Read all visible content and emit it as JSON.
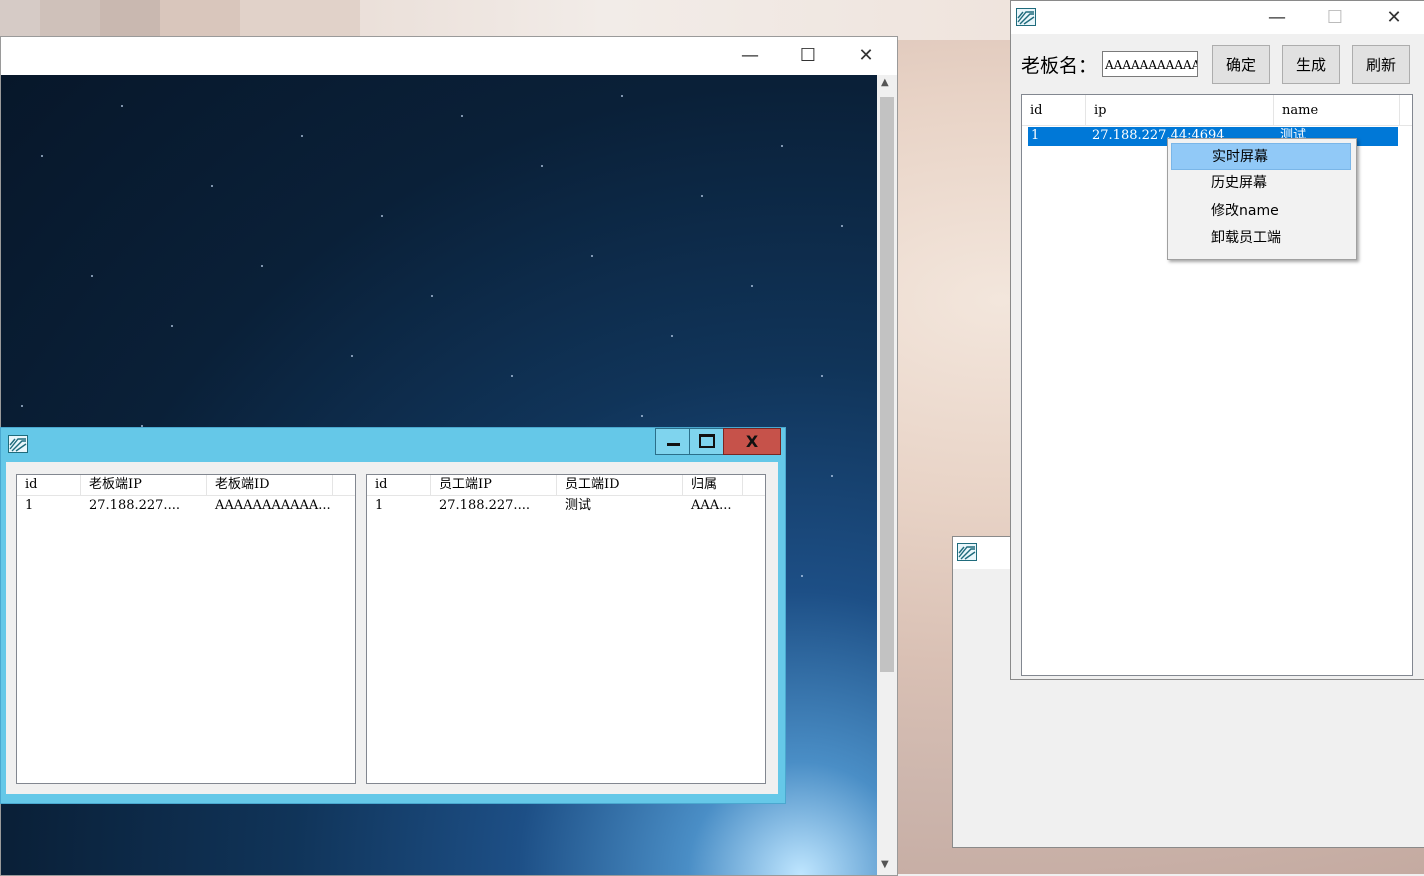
{
  "big_window": {
    "title_controls": {
      "minimize": "—",
      "maximize": "☐",
      "close": "✕"
    },
    "scroll_up": "▲",
    "scroll_down": "▼"
  },
  "client_window": {
    "buttons": {
      "close": "X"
    },
    "boss_list": {
      "columns": [
        "id",
        "老板端IP",
        "老板端ID"
      ],
      "rows": [
        [
          "1",
          "27.188.227....",
          "AAAAAAAAAAA..."
        ]
      ]
    },
    "employee_list": {
      "columns": [
        "id",
        "员工端IP",
        "员工端ID",
        "归属"
      ],
      "rows": [
        [
          "1",
          "27.188.227....",
          "测试",
          "AAA..."
        ]
      ]
    }
  },
  "boss_window": {
    "title_controls": {
      "minimize": "—",
      "maximize": "☐",
      "close": "✕"
    },
    "label": "老板名：",
    "input_value": "AAAAAAAAAAAAAA",
    "buttons": {
      "confirm": "确定",
      "generate": "生成",
      "refresh": "刷新"
    },
    "list": {
      "columns": [
        "id",
        "ip",
        "name"
      ],
      "rows": [
        [
          "1",
          "27.188.227.44:4694",
          "测试"
        ]
      ],
      "selected_row": 0
    },
    "context_menu": {
      "items": [
        "实时屏幕",
        "历史屏幕",
        "修改name",
        "卸载员工端"
      ],
      "hovered": 0
    }
  },
  "colors": {
    "selection": "#0078d7",
    "menu_hover": "#91c9f7",
    "client_frame": "#65c8e8",
    "close_red": "#c6524a"
  }
}
